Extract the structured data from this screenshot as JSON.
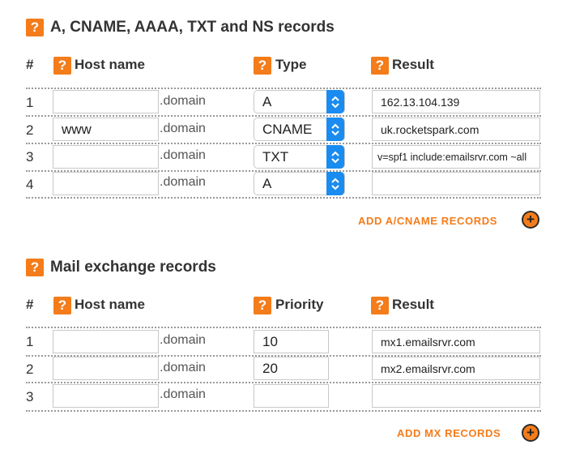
{
  "help_icon": "?",
  "domain_suffix": ".domain",
  "records": {
    "title": "A, CNAME, AAAA, TXT and NS records",
    "headers": {
      "num": "#",
      "host": "Host name",
      "type": "Type",
      "result": "Result"
    },
    "rows": [
      {
        "num": "1",
        "host": "",
        "type": "A",
        "result": "162.13.104.139"
      },
      {
        "num": "2",
        "host": "www",
        "type": "CNAME",
        "result": "uk.rocketspark.com"
      },
      {
        "num": "3",
        "host": "",
        "type": "TXT",
        "result": "v=spf1 include:emailsrvr.com ~all"
      },
      {
        "num": "4",
        "host": "",
        "type": "A",
        "result": ""
      }
    ],
    "add_label": "ADD A/CNAME RECORDS"
  },
  "mx": {
    "title": "Mail exchange records",
    "headers": {
      "num": "#",
      "host": "Host name",
      "priority": "Priority",
      "result": "Result"
    },
    "rows": [
      {
        "num": "1",
        "host": "",
        "priority": "10",
        "result": "mx1.emailsrvr.com"
      },
      {
        "num": "2",
        "host": "",
        "priority": "20",
        "result": "mx2.emailsrvr.com"
      },
      {
        "num": "3",
        "host": "",
        "priority": "",
        "result": ""
      }
    ],
    "add_label": "ADD MX RECORDS"
  },
  "colors": {
    "accent": "#f47c1a",
    "select_button": "#1a8cf0"
  },
  "icons": {
    "help": "question-icon",
    "add": "plus-circle-icon",
    "select": "up-down-chevron-icon"
  }
}
